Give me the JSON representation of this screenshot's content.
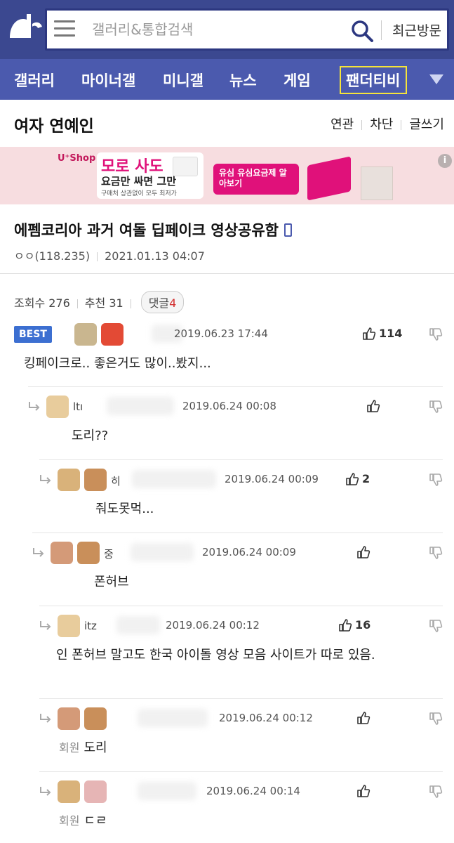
{
  "header": {
    "search_placeholder": "갤러리&통합검색",
    "recent_label": "최근방문"
  },
  "nav": {
    "items": [
      "갤러리",
      "마이너갤",
      "미니갤",
      "뉴스",
      "게임",
      "팬더티비"
    ],
    "highlighted": "팬더티비"
  },
  "gallery": {
    "title": "여자 연예인",
    "links": [
      "연관",
      "차단",
      "글쓰기"
    ]
  },
  "banner": {
    "brand": "U⁺Shop",
    "headline1": "모로 사도",
    "headline2": "요금만 싸면 그만",
    "subline": "구매처 상관없이 모두 최저가",
    "cta": "유심 유심요금제 알아보기"
  },
  "post": {
    "title": "에펨코리아 과거 여돌 딥페이크 영상공유함",
    "author": "ㅇㅇ(118.235)",
    "date": "2021.01.13 04:07",
    "views_label": "조회수 276",
    "recommend_label": "추천 31",
    "reply_label": "댓글",
    "reply_count": "4"
  },
  "comments": [
    {
      "best_label": "BEST",
      "nick": "",
      "date": "2019.06.23 17:44",
      "likes": "114",
      "text": "킹페이크로.. 좋은거도 많이..봤지...",
      "member": ""
    },
    {
      "nick": "ltı",
      "date": "2019.06.24 00:08",
      "likes": "",
      "text": "도리??",
      "member": ""
    },
    {
      "nick": "히",
      "date": "2019.06.24 00:09",
      "likes": "2",
      "text": "줘도못먹...",
      "member": ""
    },
    {
      "nick": "중",
      "date": "2019.06.24 00:09",
      "likes": "",
      "text": "폰허브",
      "member": ""
    },
    {
      "nick": "itz",
      "date": "2019.06.24 00:12",
      "likes": "16",
      "text": "인 폰허브 말고도 한국 아이돌 영상 모음 사이트가 따로 있음.",
      "member": ""
    },
    {
      "nick": "",
      "date": "2019.06.24 00:12",
      "likes": "",
      "text": "도리",
      "member": "회원"
    },
    {
      "nick": "",
      "date": "2019.06.24 00:14",
      "likes": "",
      "text": "ㄷㄹ",
      "member": "회원"
    }
  ],
  "colors": {
    "header_bg": "#3b4890",
    "nav_bg": "#4b5aae",
    "highlight_border": "#f6e43a",
    "best_badge": "#3c6fd1",
    "banner_bg": "#f7dde0"
  }
}
